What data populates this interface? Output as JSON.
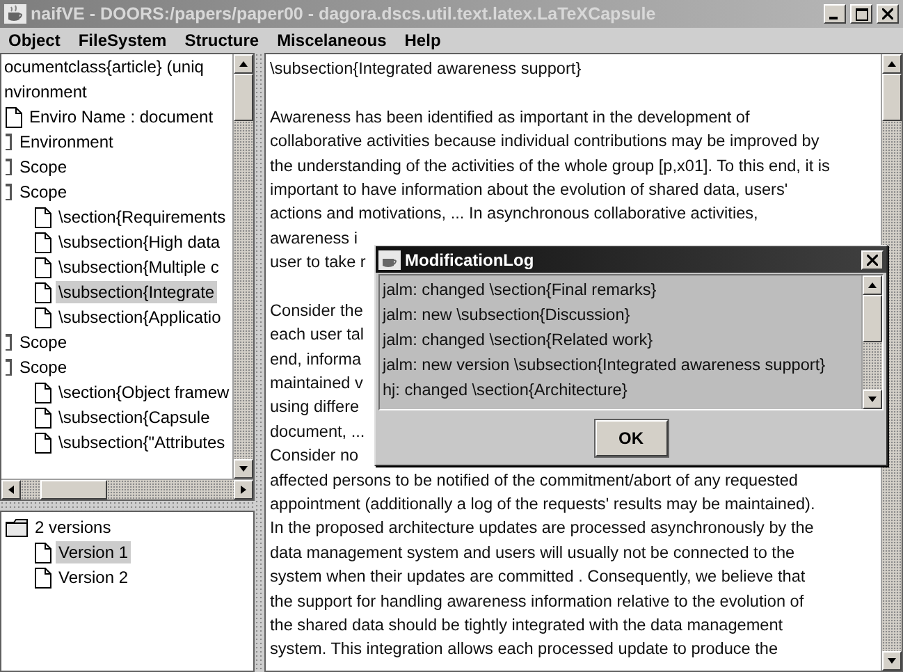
{
  "window": {
    "title": "naifVE - DOORS:/papers/paper00 - dagora.dscs.util.text.latex.LaTeXCapsule"
  },
  "menu": [
    "Object",
    "FileSystem",
    "Structure",
    "Miscelaneous",
    "Help"
  ],
  "structure_tree": {
    "items": [
      {
        "label": "ocumentclass{article} (uniq",
        "selected": false,
        "children": [
          {
            "label": "nvironment",
            "selected": false,
            "children": [
              {
                "label": "Enviro Name : document",
                "kind": "doc",
                "selected": false
              },
              {
                "label": "Environment",
                "kind": "node",
                "selected": false
              },
              {
                "label": "Scope",
                "kind": "node",
                "selected": false
              },
              {
                "label": "Scope",
                "kind": "node",
                "selected": false,
                "children": [
                  {
                    "label": "\\section{Requirements",
                    "kind": "doc",
                    "selected": false
                  },
                  {
                    "label": "\\subsection{High data",
                    "kind": "doc",
                    "selected": false
                  },
                  {
                    "label": "\\subsection{Multiple c",
                    "kind": "doc",
                    "selected": false
                  },
                  {
                    "label": "\\subsection{Integrate",
                    "kind": "doc",
                    "selected": true
                  },
                  {
                    "label": "\\subsection{Applicatio",
                    "kind": "doc",
                    "selected": false
                  }
                ]
              },
              {
                "label": "Scope",
                "kind": "node",
                "selected": false
              },
              {
                "label": "Scope",
                "kind": "node",
                "selected": false,
                "children": [
                  {
                    "label": "\\section{Object framew",
                    "kind": "doc",
                    "selected": false
                  },
                  {
                    "label": "\\subsection{Capsule",
                    "kind": "doc",
                    "selected": false
                  },
                  {
                    "label": "\\subsection{\"Attributes",
                    "kind": "doc",
                    "selected": false
                  }
                ]
              }
            ]
          }
        ]
      }
    ]
  },
  "versions_tree": {
    "items": [
      {
        "label": "2 versions",
        "kind": "folder",
        "selected": false,
        "children": [
          {
            "label": "Version 1",
            "kind": "doc",
            "selected": true
          },
          {
            "label": "Version 2",
            "kind": "doc",
            "selected": false
          }
        ]
      }
    ]
  },
  "editor": {
    "paragraphs": [
      [
        "\\subsection{Integrated awareness support}"
      ],
      [
        "Awareness has been identified as important in the development of",
        "collaborative activities because individual contributions may be improved by",
        "the understanding of the activities of the whole group [p,x01]. To this end, it is",
        "important to have information about the evolution of shared data, users'",
        "actions and motivations, ... In asynchronous collaborative activities,",
        "awareness i",
        "user to take r"
      ],
      [
        "Consider the",
        "each user tal",
        "end, informa",
        "maintained v",
        "using differe",
        "document, ...",
        "Consider no",
        "affected persons to be notified of the commitment/abort of any requested",
        "appointment (additionally a log of the requests' results may be maintained).",
        "In the proposed architecture updates are processed asynchronously by the",
        "data management system and users will usually not be connected to the",
        "system when their updates are committed . Consequently, we believe that",
        "the support for handling awareness information relative to the evolution of",
        "the shared data should be tightly integrated with the data management",
        "system. This integration allows each processed update to produce the"
      ]
    ]
  },
  "dialog": {
    "title": "ModificationLog",
    "entries": [
      "jalm: changed \\section{Final remarks}",
      "jalm: new \\subsection{Discussion}",
      "jalm: changed \\section{Related work}",
      "jalm: new version \\subsection{Integrated awareness support}",
      "hj: changed \\section{Architecture}"
    ],
    "button": "OK"
  }
}
